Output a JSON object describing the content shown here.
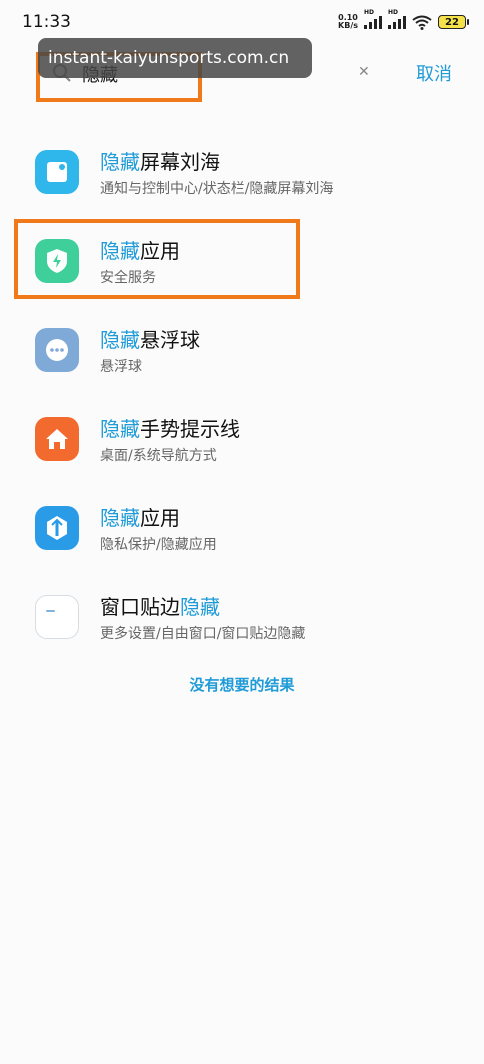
{
  "status_bar": {
    "time": "11:33",
    "net_speed": "0.10",
    "net_unit": "KB/s",
    "hd1": "HD",
    "hd2": "HD",
    "battery": "22"
  },
  "search": {
    "query": "隐藏",
    "cancel_label": "取消",
    "overlay_text": "instant-kaiyunsports.com.cn"
  },
  "results": [
    {
      "kw": "隐藏",
      "rest": "屏幕刘海",
      "subtitle": "通知与控制中心/状态栏/隐藏屏幕刘海",
      "icon": "notch-settings-icon",
      "color": "#2fb6ea"
    },
    {
      "kw": "隐藏",
      "rest": "应用",
      "subtitle": "安全服务",
      "icon": "security-shield-icon",
      "color": "#3fcf9a"
    },
    {
      "kw": "隐藏",
      "rest": "悬浮球",
      "subtitle": "悬浮球",
      "icon": "floating-ball-icon",
      "color": "#7fa9d6"
    },
    {
      "kw": "隐藏",
      "rest": "手势提示线",
      "subtitle": "桌面/系统导航方式",
      "icon": "home-icon",
      "color": "#f26a2e"
    },
    {
      "kw": "隐藏",
      "rest": "应用",
      "subtitle": "隐私保护/隐藏应用",
      "icon": "privacy-icon",
      "color": "#2a9be6"
    },
    {
      "pre": "窗口贴边",
      "kw": "隐藏",
      "subtitle": "更多设置/自由窗口/窗口贴边隐藏",
      "icon": "window-edge-icon",
      "color": "#ffffff"
    }
  ],
  "no_result_label": "没有想要的结果"
}
